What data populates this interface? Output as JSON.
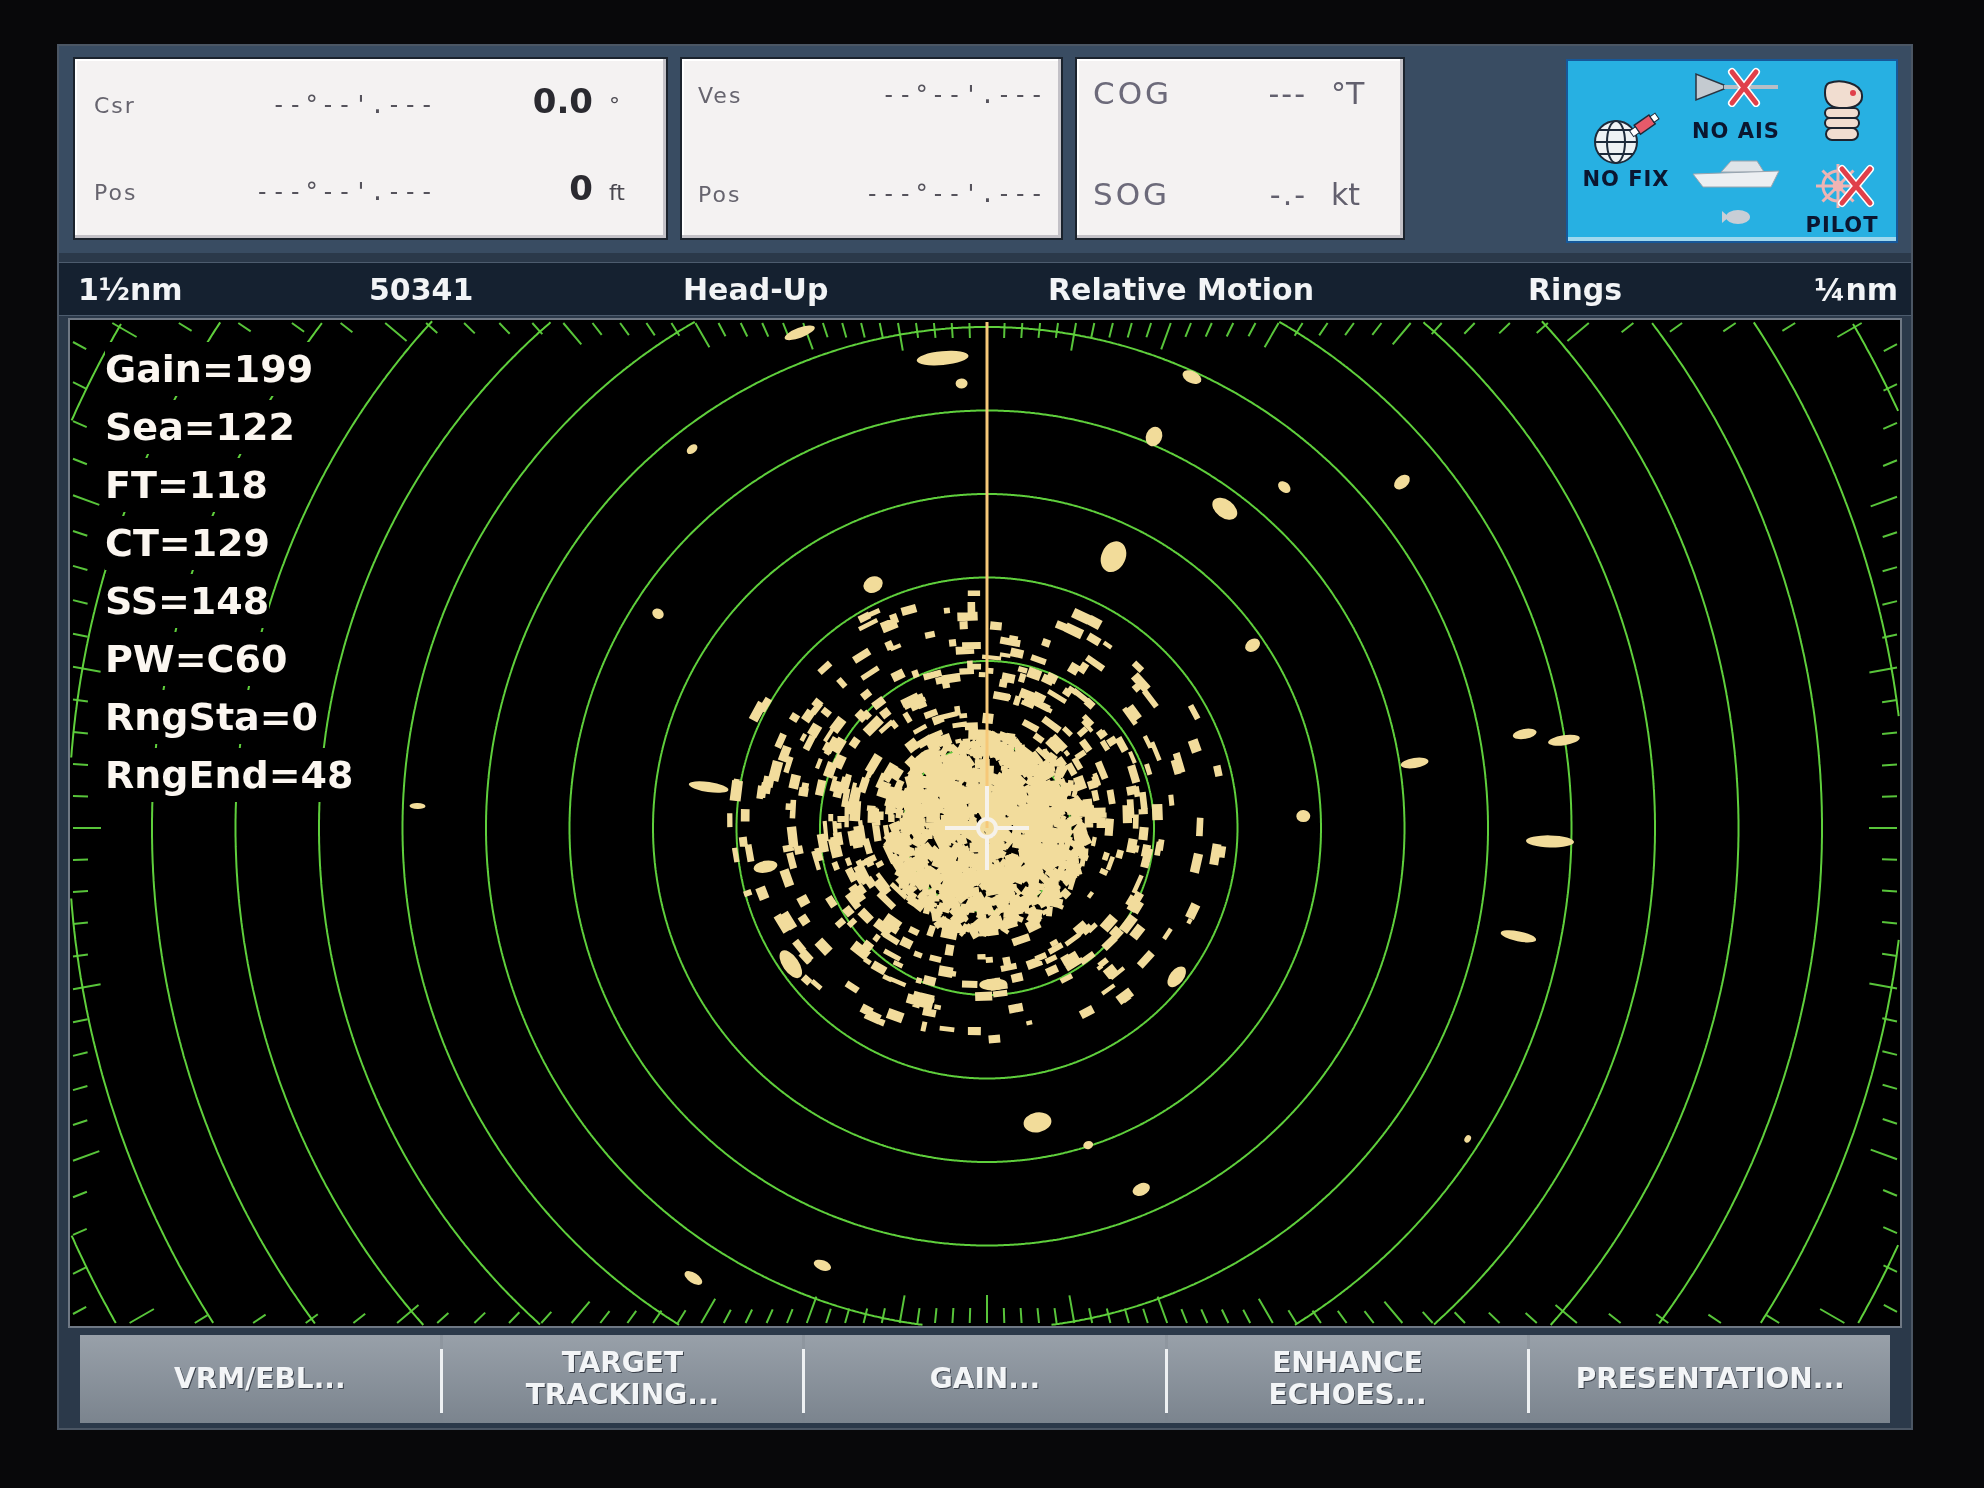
{
  "data_boxes": [
    {
      "kind": "cursor",
      "rows": [
        {
          "label": "Csr",
          "position": "--°--'.---",
          "value": "0.0",
          "unit": "°"
        },
        {
          "label": "Pos",
          "position": "---°--'.---",
          "value": "0",
          "unit": "ft"
        }
      ]
    },
    {
      "kind": "vessel",
      "rows": [
        {
          "label": "Ves",
          "position": "--°--'.---"
        },
        {
          "label": "Pos",
          "position": "---°--'.---"
        }
      ]
    },
    {
      "kind": "motion",
      "rows": [
        {
          "label": "COG",
          "value": "---",
          "unit": "°T"
        },
        {
          "label": "SOG",
          "value": "-.-",
          "unit": "kt"
        }
      ]
    }
  ],
  "status_panel": {
    "fix": {
      "label": "NO FIX"
    },
    "ais": {
      "label": "NO AIS",
      "crossed": true
    },
    "pilot": {
      "label": "PILOT",
      "crossed": true
    }
  },
  "header_bar": [
    "1½nm",
    "50341",
    "Head-Up",
    "Relative Motion",
    "Rings",
    "¼nm"
  ],
  "readouts": [
    "Gain=199",
    "Sea=122",
    "FT=118",
    "CT=129",
    "SS=148",
    "PW=C60",
    "RngSta=0",
    "RngEnd=48"
  ],
  "softkeys": [
    "VRM/EBL...",
    "TARGET TRACKING...",
    "GAIN...",
    "ENHANCE ECHOES...",
    "PRESENTATION..."
  ]
}
